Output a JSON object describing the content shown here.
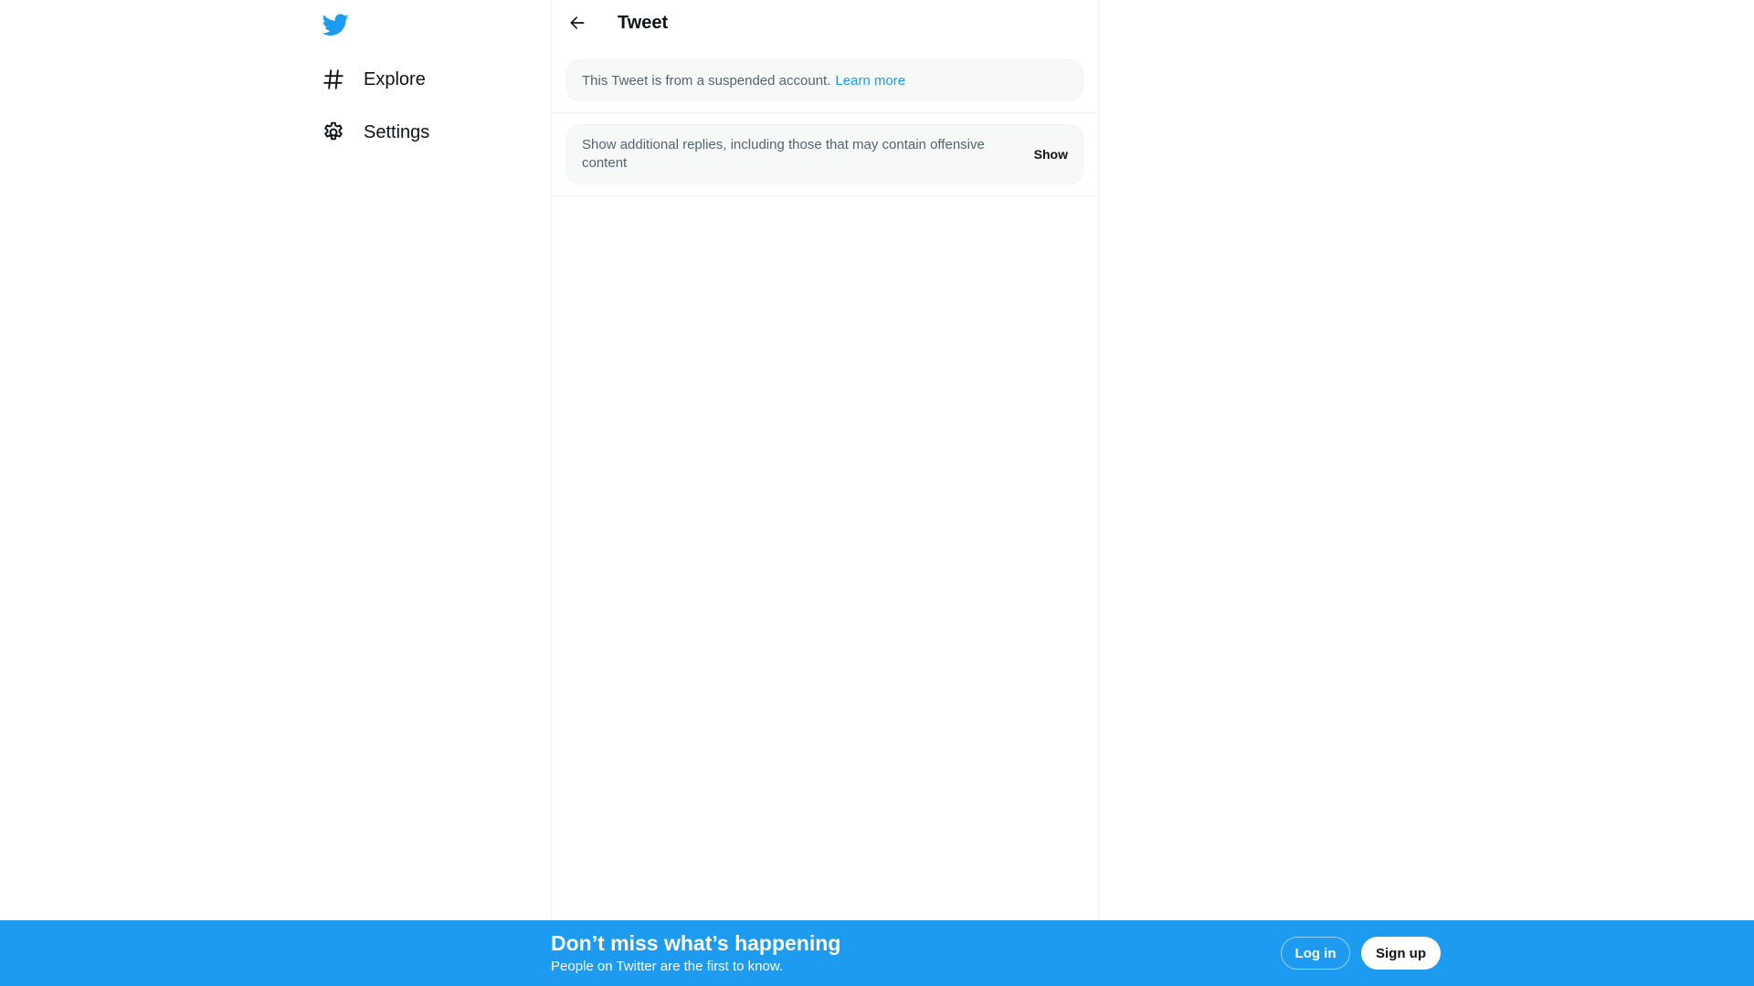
{
  "colors": {
    "brand": "#1d9bf0",
    "text_primary": "#0f1419",
    "text_secondary": "#536471",
    "border": "#eff3f4",
    "notice_bg": "#f7f9f9"
  },
  "sidebar": {
    "logo_icon": "twitter-bird-icon",
    "items": [
      {
        "label": "Explore",
        "icon": "hashtag-icon"
      },
      {
        "label": "Settings",
        "icon": "gear-icon"
      }
    ]
  },
  "header": {
    "back_icon": "arrow-left-icon",
    "title": "Tweet"
  },
  "notice": {
    "text": "This Tweet is from a suspended account.",
    "link_label": "Learn more"
  },
  "replies": {
    "text": "Show additional replies, including those that may contain offensive content",
    "button_label": "Show"
  },
  "banner": {
    "title": "Don’t miss what’s happening",
    "subtitle": "People on Twitter are the first to know.",
    "login_label": "Log in",
    "signup_label": "Sign up"
  }
}
